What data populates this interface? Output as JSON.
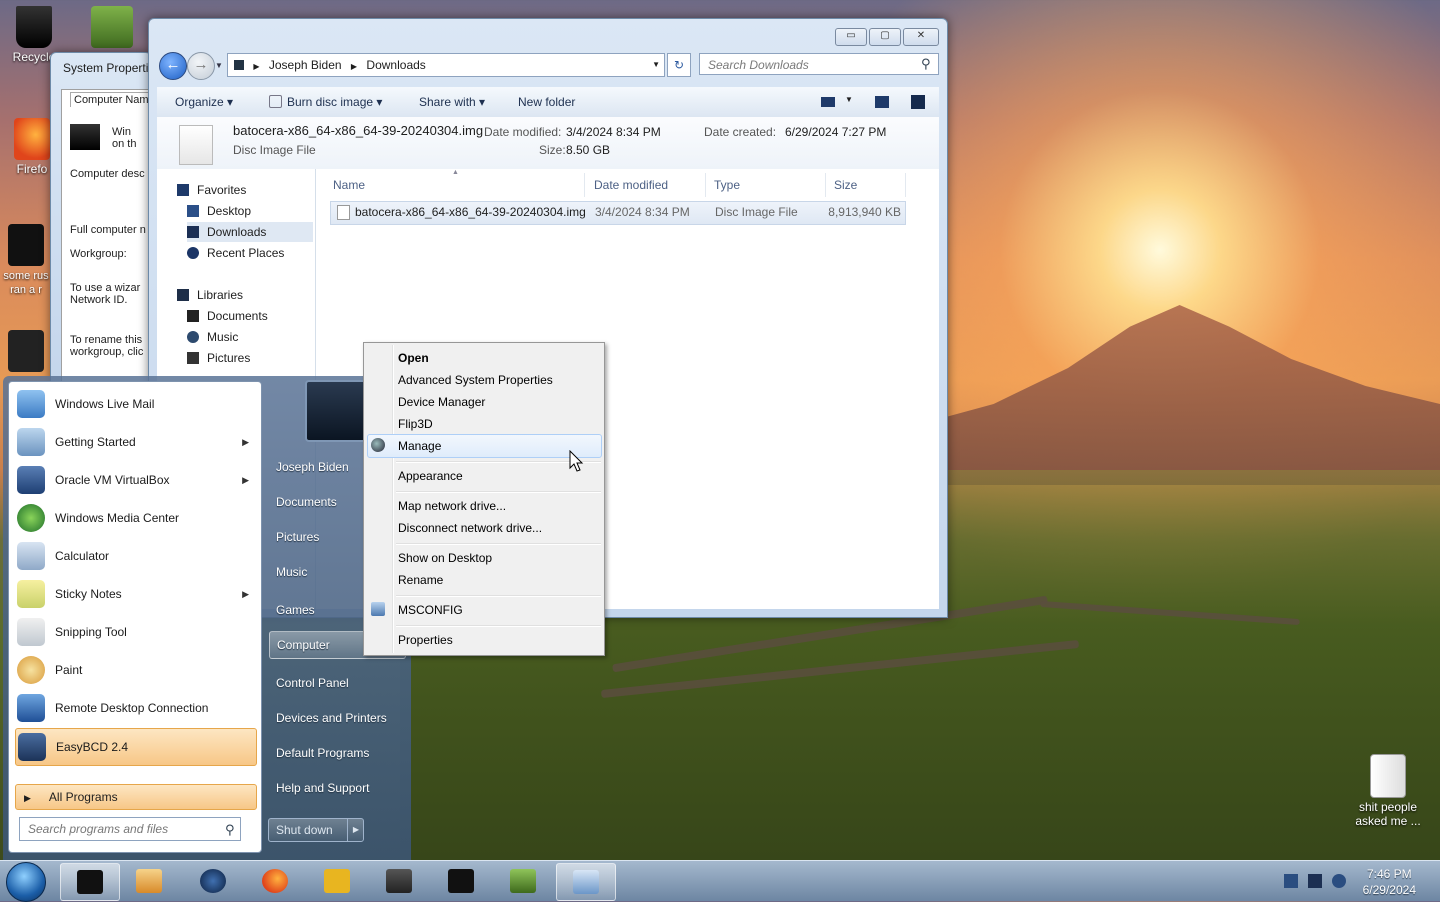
{
  "desktop": {
    "icons": [
      {
        "label": "Recycle"
      },
      {
        "label": "Firefo"
      },
      {
        "label": "some rus ran a r"
      },
      {
        "label": "shit people asked me ..."
      }
    ]
  },
  "system_properties": {
    "title": "System Properti",
    "tab": "Computer Name",
    "lines": [
      "Win on th",
      "Computer desc",
      "Full computer n",
      "Workgroup:",
      "To use a wizar Network ID.",
      "To rename this workgroup, clic"
    ]
  },
  "explorer": {
    "caption": {
      "minimize": "▭",
      "maximize": "▢",
      "close": "✕"
    },
    "breadcrumb": [
      "Joseph Biden",
      "Downloads"
    ],
    "search_placeholder": "Search Downloads",
    "toolbar": {
      "organize": "Organize",
      "burn": "Burn disc image",
      "share": "Share with",
      "new_folder": "New folder"
    },
    "details": {
      "filename": "batocera-x86_64-x86_64-39-20240304.img",
      "type": "Disc Image File",
      "date_modified_label": "Date modified:",
      "date_modified": "3/4/2024 8:34 PM",
      "size_label": "Size:",
      "size": "8.50 GB",
      "date_created_label": "Date created:",
      "date_created": "6/29/2024 7:27 PM"
    },
    "nav": {
      "favorites": "Favorites",
      "desktop": "Desktop",
      "downloads": "Downloads",
      "recent": "Recent Places",
      "libraries": "Libraries",
      "documents": "Documents",
      "music": "Music",
      "pictures": "Pictures"
    },
    "columns": [
      "Name",
      "Date modified",
      "Type",
      "Size"
    ],
    "rows": [
      {
        "name": "batocera-x86_64-x86_64-39-20240304.img",
        "date": "3/4/2024 8:34 PM",
        "type": "Disc Image File",
        "size": "8,913,940 KB"
      }
    ]
  },
  "start_menu": {
    "programs": [
      {
        "label": "Windows Live Mail",
        "arrow": false
      },
      {
        "label": "Getting Started",
        "arrow": true
      },
      {
        "label": "Oracle VM VirtualBox",
        "arrow": true
      },
      {
        "label": "Windows Media Center",
        "arrow": false
      },
      {
        "label": "Calculator",
        "arrow": false
      },
      {
        "label": "Sticky Notes",
        "arrow": true
      },
      {
        "label": "Snipping Tool",
        "arrow": false
      },
      {
        "label": "Paint",
        "arrow": false
      },
      {
        "label": "Remote Desktop Connection",
        "arrow": false
      },
      {
        "label": "EasyBCD 2.4",
        "arrow": false
      }
    ],
    "all_programs": "All Programs",
    "search_placeholder": "Search programs and files",
    "right_links": [
      "Joseph Biden",
      "Documents",
      "Pictures",
      "Music",
      "Games",
      "Computer",
      "Control Panel",
      "Devices and Printers",
      "Default Programs",
      "Help and Support"
    ],
    "shutdown": "Shut down"
  },
  "context_menu": {
    "items": [
      "Open",
      "Advanced System Properties",
      "Device Manager",
      "Flip3D",
      "Manage",
      "Appearance",
      "Map network drive...",
      "Disconnect network drive...",
      "Show on Desktop",
      "Rename",
      "MSCONFIG",
      "Properties"
    ]
  },
  "taskbar": {
    "time": "7:46 PM",
    "date": "6/29/2024"
  },
  "colors": {
    "accent": "#1d5fc4",
    "highlight": "#f7c787",
    "menu_hover": "#dfecfb"
  }
}
